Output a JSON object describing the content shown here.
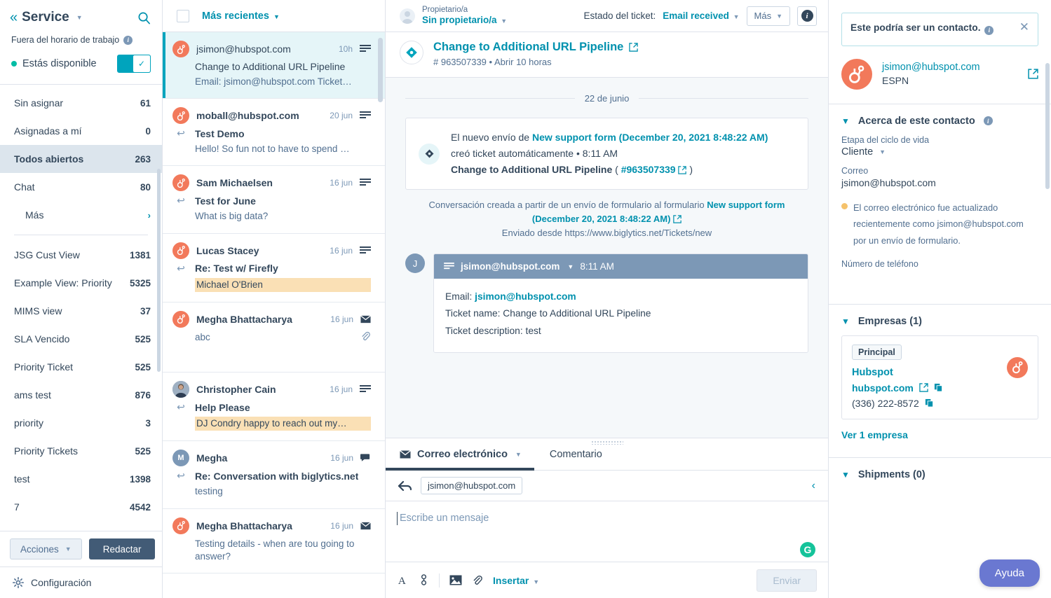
{
  "sidebar": {
    "app_title": "Service",
    "collapse_icon": "chevron-double-left-icon",
    "search_icon": "search-icon",
    "out_of_hours": "Fuera del horario de trabajo",
    "availability_label": "Estás disponible",
    "views": [
      {
        "label": "Sin asignar",
        "count": "61",
        "active": false
      },
      {
        "label": "Asignadas a mí",
        "count": "0",
        "active": false
      },
      {
        "label": "Todos abiertos",
        "count": "263",
        "active": true
      },
      {
        "label": "Chat",
        "count": "80",
        "active": false
      }
    ],
    "more_label": "Más",
    "custom_views": [
      {
        "label": "JSG Cust View",
        "count": "1381"
      },
      {
        "label": "Example View: Priority",
        "count": "5325"
      },
      {
        "label": "MIMS view",
        "count": "37"
      },
      {
        "label": "SLA Vencido",
        "count": "525"
      },
      {
        "label": "Priority Ticket",
        "count": "525"
      },
      {
        "label": "ams test",
        "count": "876"
      },
      {
        "label": "priority",
        "count": "3"
      },
      {
        "label": "Priority Tickets",
        "count": "525"
      },
      {
        "label": "test",
        "count": "1398"
      },
      {
        "label": "7",
        "count": "4542"
      }
    ],
    "actions_label": "Acciones",
    "compose_label": "Redactar",
    "settings_label": "Configuración",
    "accent_teal": "#00a4bd",
    "primary_navy": "#425b76"
  },
  "conversation_list": {
    "sort_label": "Más recientes",
    "items": [
      {
        "name": "jsimon@hubspot.com",
        "time": "10h",
        "subject": "Change to Additional URL Pipeline",
        "preview": "Email: jsimon@hubspot.com Ticket…",
        "avatar": "hubspot-sprocket",
        "avatar_letter": "",
        "channel_icon": "email-thread-icon",
        "selected": true,
        "unread": false,
        "has_reply_icon": false,
        "highlight": false,
        "has_attachment": false
      },
      {
        "name": "moball@hubspot.com",
        "time": "20 jun",
        "subject": "Test Demo",
        "preview": "Hello! So fun not to have to spend …",
        "avatar": "hubspot-sprocket",
        "avatar_letter": "",
        "channel_icon": "email-thread-icon",
        "selected": false,
        "unread": true,
        "has_reply_icon": true,
        "highlight": false,
        "has_attachment": false
      },
      {
        "name": "Sam Michaelsen",
        "time": "16 jun",
        "subject": "Test for June",
        "preview": "What is big data?",
        "avatar": "hubspot-sprocket",
        "avatar_letter": "",
        "channel_icon": "email-thread-icon",
        "selected": false,
        "unread": true,
        "has_reply_icon": true,
        "highlight": false,
        "has_attachment": false
      },
      {
        "name": "Lucas Stacey",
        "time": "16 jun",
        "subject": "Re: Test w/ Firefly",
        "preview": "Michael O'Brien",
        "avatar": "hubspot-sprocket",
        "avatar_letter": "",
        "channel_icon": "email-thread-icon",
        "selected": false,
        "unread": true,
        "has_reply_icon": true,
        "highlight": true,
        "has_attachment": false
      },
      {
        "name": "Megha Bhattacharya",
        "time": "16 jun",
        "subject": "",
        "preview": "abc",
        "avatar": "hubspot-sprocket",
        "avatar_letter": "",
        "channel_icon": "envelope-icon",
        "selected": false,
        "unread": true,
        "has_reply_icon": false,
        "highlight": false,
        "has_attachment": true
      },
      {
        "name": "Christopher Cain",
        "time": "16 jun",
        "subject": "Help Please",
        "preview": "DJ Condry happy to reach out my…",
        "avatar": "user-photo",
        "avatar_letter": "",
        "channel_icon": "email-thread-icon",
        "selected": false,
        "unread": true,
        "has_reply_icon": true,
        "highlight": true,
        "has_attachment": false
      },
      {
        "name": "Megha",
        "time": "16 jun",
        "subject": "Re: Conversation with biglytics.net",
        "preview": "testing",
        "avatar": "letter-blue",
        "avatar_letter": "M",
        "channel_icon": "chat-bubble-icon",
        "selected": false,
        "unread": true,
        "has_reply_icon": true,
        "highlight": false,
        "has_attachment": false
      },
      {
        "name": "Megha Bhattacharya",
        "time": "16 jun",
        "subject": "",
        "preview": "Testing details - when are tou going to answer?",
        "avatar": "hubspot-sprocket",
        "avatar_letter": "",
        "channel_icon": "envelope-icon",
        "selected": false,
        "unread": true,
        "has_reply_icon": false,
        "highlight": false,
        "has_attachment": false
      }
    ]
  },
  "main_header": {
    "owner_label": "Propietario/a",
    "owner_value": "Sin propietario/a",
    "status_label": "Estado del ticket:",
    "status_value": "Email received",
    "more_label": "Más",
    "info_icon": "info-circle-icon"
  },
  "ticket": {
    "title": "Change to Additional URL Pipeline",
    "external_icon": "external-link-icon",
    "number": "# 963507339",
    "separator": "•",
    "age": "Abrir 10 horas",
    "icon": "ticket-diamond-icon"
  },
  "thread": {
    "date_separator": "22 de junio",
    "system_card": {
      "prefix": "El nuevo envío de ",
      "form_link": "New support form (December 20, 2021 8:48:22 AM)",
      "line2": "creó ticket automáticamente • 8:11 AM",
      "ticket_name": "Change to Additional URL Pipeline",
      "paren_open": "(",
      "ticket_link": "#963507339",
      "paren_close": ")"
    },
    "note_prefix": "Conversación creada a partir de un envío de formulario al formulario ",
    "note_link": "New support form (December 20, 2021 8:48:22 AM)",
    "sent_from": "Enviado desde https://www.biglytics.net/Tickets/new",
    "message": {
      "avatar_letter": "J",
      "from": "jsimon@hubspot.com",
      "time": "8:11 AM",
      "body_line1_label": "Email: ",
      "body_line1_value": "jsimon@hubspot.com",
      "body_line2": "Ticket name: Change to Additional URL Pipeline",
      "body_line3": "Ticket description: test"
    }
  },
  "editor": {
    "tab_email": "Correo electrónico",
    "tab_comment": "Comentario",
    "recipient": "jsimon@hubspot.com",
    "placeholder": "Escribe un mensaje",
    "insert_label": "Insertar",
    "send_label": "Enviar",
    "grammarly_icon": "grammarly-icon",
    "toolbar_icons": [
      "font-format-icon",
      "link-icon",
      "image-icon",
      "attachment-icon"
    ]
  },
  "right_panel": {
    "callout_text": "Este podría ser un contacto.",
    "callout_info_icon": "info-circle-icon",
    "close_icon": "close-icon",
    "contact_email": "jsimon@hubspot.com",
    "contact_company": "ESPN",
    "about_section": "Acerca de este contacto",
    "lifecycle_label": "Etapa del ciclo de vida",
    "lifecycle_value": "Cliente",
    "email_label": "Correo",
    "email_value": "jsimon@hubspot.com",
    "warning_text": "El correo electrónico fue actualizado recientemente como jsimon@hubspot.com por un envío de formulario.",
    "phone_label": "Número de teléfono",
    "companies_section": "Empresas (1)",
    "company_chip": "Principal",
    "company_name": "Hubspot",
    "company_domain": "hubspot.com",
    "company_phone": "(336) 222-8572",
    "see_companies": "Ver 1 empresa",
    "shipments_section": "Shipments (0)",
    "help_label": "Ayuda",
    "help_color": "#6a78d1"
  }
}
